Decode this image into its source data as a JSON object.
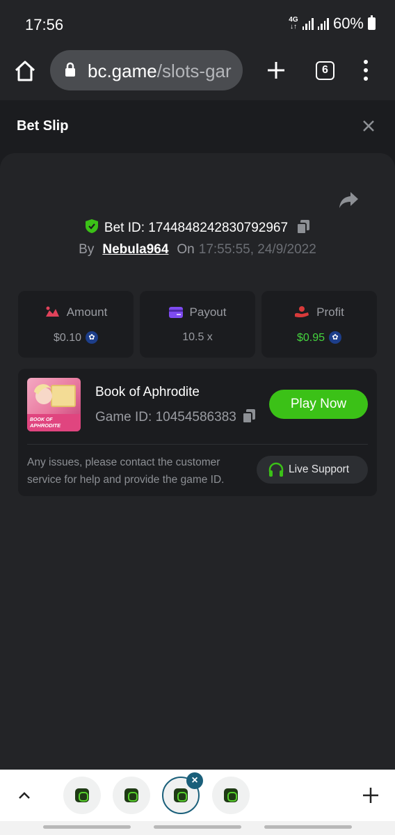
{
  "status_bar": {
    "time": "17:56",
    "network": "4G",
    "battery": "60%"
  },
  "browser": {
    "url_host": "bc.game",
    "url_path": "/slots-gar",
    "tab_count": "6"
  },
  "bet_slip": {
    "title": "Bet Slip",
    "bet_id_label": "Bet ID:",
    "bet_id": "1744848242830792967",
    "by_label": "By",
    "username": "Nebula964",
    "on_label": "On",
    "datetime": "17:55:55, 24/9/2022",
    "stats": [
      {
        "label": "Amount",
        "value": "$0.10",
        "icon": "amount-icon",
        "color": "#e0425a"
      },
      {
        "label": "Payout",
        "value": "10.5 x",
        "icon": "payout-icon",
        "color": "#7e4bf0"
      },
      {
        "label": "Profit",
        "value": "$0.95",
        "icon": "profit-icon",
        "color": "#d83a3a"
      }
    ],
    "game": {
      "name": "Book of Aphrodite",
      "id_label": "Game ID:",
      "id": "10454586383",
      "thumb_text": "BOOK OF APHRODITE",
      "play_label": "Play Now"
    },
    "help_text": "Any issues, please contact the customer service for help and provide the game ID.",
    "live_support_label": "Live Support"
  },
  "colors": {
    "accent_green": "#3bc117",
    "profit_green": "#45d43e",
    "tab_active": "#1a5f7a"
  }
}
